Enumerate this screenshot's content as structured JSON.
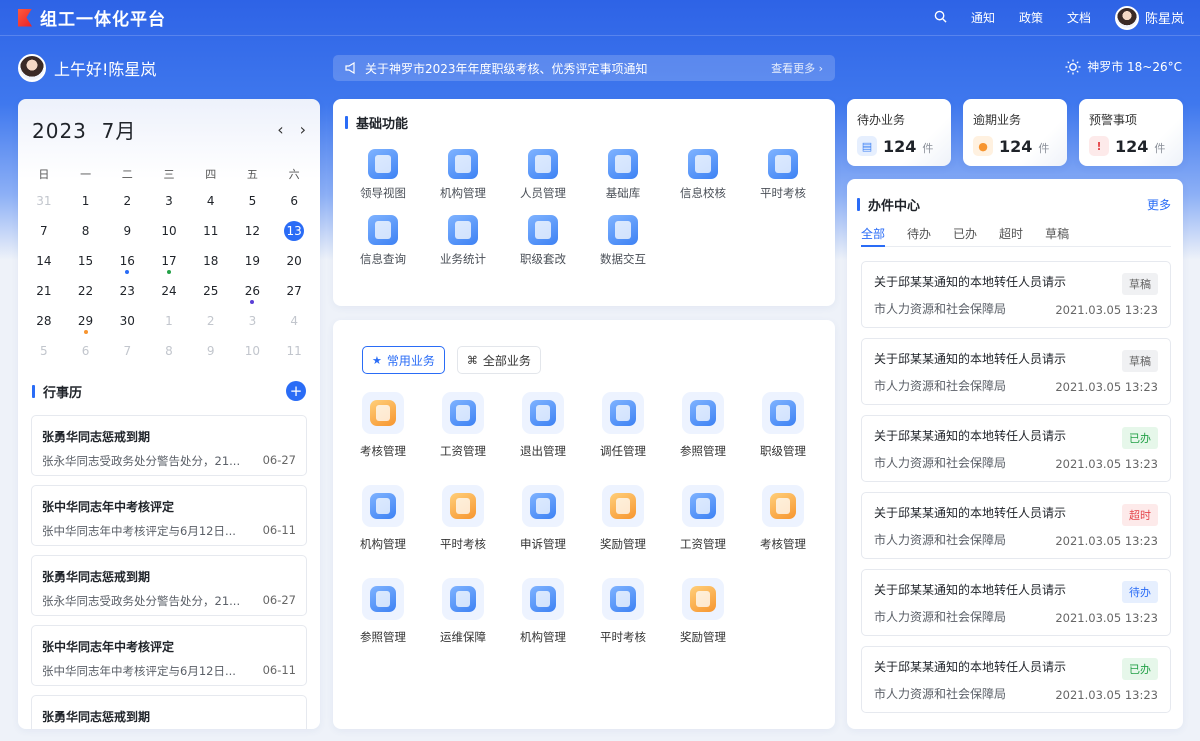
{
  "app": {
    "title": "组工一体化平台"
  },
  "topnav": {
    "notify": "通知",
    "policy": "政策",
    "docs": "文档",
    "user": "陈星岚"
  },
  "greeting": "上午好!陈星岚",
  "notice": {
    "text": "关于神罗市2023年年度职级考核、优秀评定事项通知",
    "more": "查看更多"
  },
  "weather": {
    "text": "神罗市 18~26°C"
  },
  "calendar": {
    "title": "2023  7月",
    "weekdays": [
      "日",
      "一",
      "二",
      "三",
      "四",
      "五",
      "六"
    ],
    "days": [
      {
        "n": "31",
        "m": true
      },
      {
        "n": "1"
      },
      {
        "n": "2"
      },
      {
        "n": "3"
      },
      {
        "n": "4"
      },
      {
        "n": "5"
      },
      {
        "n": "6"
      },
      {
        "n": "7"
      },
      {
        "n": "8"
      },
      {
        "n": "9"
      },
      {
        "n": "10"
      },
      {
        "n": "11"
      },
      {
        "n": "12"
      },
      {
        "n": "13",
        "today": true
      },
      {
        "n": "14"
      },
      {
        "n": "15"
      },
      {
        "n": "16",
        "dot": "#2a6cf6"
      },
      {
        "n": "17",
        "dot": "#24a148"
      },
      {
        "n": "18"
      },
      {
        "n": "19"
      },
      {
        "n": "20"
      },
      {
        "n": "21"
      },
      {
        "n": "22"
      },
      {
        "n": "23"
      },
      {
        "n": "24"
      },
      {
        "n": "25"
      },
      {
        "n": "26",
        "dot": "#5b3fd6"
      },
      {
        "n": "27"
      },
      {
        "n": "28"
      },
      {
        "n": "29",
        "dot": "#f7952f"
      },
      {
        "n": "30"
      },
      {
        "n": "1",
        "m": true
      },
      {
        "n": "2",
        "m": true
      },
      {
        "n": "3",
        "m": true
      },
      {
        "n": "4",
        "m": true
      },
      {
        "n": "5",
        "m": true
      },
      {
        "n": "6",
        "m": true
      },
      {
        "n": "7",
        "m": true
      },
      {
        "n": "8",
        "m": true
      },
      {
        "n": "9",
        "m": true
      },
      {
        "n": "10",
        "m": true
      },
      {
        "n": "11",
        "m": true
      }
    ]
  },
  "schedule": {
    "title": "行事历",
    "items": [
      {
        "title": "张勇华同志惩戒到期",
        "desc": "张永华同志受政务处分警告处分，21...",
        "date": "06-27"
      },
      {
        "title": "张中华同志年中考核评定",
        "desc": "张中华同志年中考核评定与6月12日...",
        "date": "06-11"
      },
      {
        "title": "张勇华同志惩戒到期",
        "desc": "张永华同志受政务处分警告处分，21...",
        "date": "06-27"
      },
      {
        "title": "张中华同志年中考核评定",
        "desc": "张中华同志年中考核评定与6月12日...",
        "date": "06-11"
      },
      {
        "title": "张勇华同志惩戒到期",
        "desc": "",
        "date": ""
      }
    ]
  },
  "basic": {
    "title": "基础功能",
    "items": [
      {
        "label": "领导视图",
        "icon": "leader-icon"
      },
      {
        "label": "机构管理",
        "icon": "building-icon"
      },
      {
        "label": "人员管理",
        "icon": "person-icon"
      },
      {
        "label": "基础库",
        "icon": "library-icon"
      },
      {
        "label": "信息校核",
        "icon": "check-icon"
      },
      {
        "label": "平时考核",
        "icon": "assessment-icon"
      },
      {
        "label": "信息查询",
        "icon": "query-icon"
      },
      {
        "label": "业务统计",
        "icon": "stats-icon"
      },
      {
        "label": "职级套改",
        "icon": "rank-icon"
      },
      {
        "label": "数据交互",
        "icon": "data-exchange-icon"
      }
    ]
  },
  "business": {
    "tabs": [
      "常用业务",
      "全部业务"
    ],
    "items": [
      {
        "label": "考核管理",
        "c": "orange"
      },
      {
        "label": "工资管理",
        "c": "blue"
      },
      {
        "label": "退出管理",
        "c": "blue"
      },
      {
        "label": "调任管理",
        "c": "blue"
      },
      {
        "label": "参照管理",
        "c": "blue"
      },
      {
        "label": "职级管理",
        "c": "blue"
      },
      {
        "label": "机构管理",
        "c": "blue"
      },
      {
        "label": "平时考核",
        "c": "orange"
      },
      {
        "label": "申诉管理",
        "c": "blue"
      },
      {
        "label": "奖励管理",
        "c": "orange"
      },
      {
        "label": "工资管理",
        "c": "blue"
      },
      {
        "label": "考核管理",
        "c": "orange"
      },
      {
        "label": "参照管理",
        "c": "blue"
      },
      {
        "label": "运维保障",
        "c": "blue"
      },
      {
        "label": "机构管理",
        "c": "blue"
      },
      {
        "label": "平时考核",
        "c": "blue"
      },
      {
        "label": "奖励管理",
        "c": "orange"
      }
    ]
  },
  "stats": [
    {
      "label": "待办业务",
      "value": "124",
      "unit": "件",
      "color": "#3e82f4",
      "bg": "#e6effe"
    },
    {
      "label": "逾期业务",
      "value": "124",
      "unit": "件",
      "color": "#f7952f",
      "bg": "#fff1e0"
    },
    {
      "label": "预警事项",
      "value": "124",
      "unit": "件",
      "color": "#e5484d",
      "bg": "#fdeaea"
    }
  ],
  "office": {
    "title": "办件中心",
    "more": "更多",
    "tabs": [
      "全部",
      "待办",
      "已办",
      "超时",
      "草稿"
    ],
    "items": [
      {
        "title": "关于邱某某通知的本地转任人员请示",
        "org": "市人力资源和社会保障局",
        "time": "2021.03.05 13:23",
        "status": "草稿",
        "cls": "b-draft"
      },
      {
        "title": "关于邱某某通知的本地转任人员请示",
        "org": "市人力资源和社会保障局",
        "time": "2021.03.05 13:23",
        "status": "草稿",
        "cls": "b-draft"
      },
      {
        "title": "关于邱某某通知的本地转任人员请示",
        "org": "市人力资源和社会保障局",
        "time": "2021.03.05 13:23",
        "status": "已办",
        "cls": "b-done"
      },
      {
        "title": "关于邱某某通知的本地转任人员请示",
        "org": "市人力资源和社会保障局",
        "time": "2021.03.05 13:23",
        "status": "超时",
        "cls": "b-late"
      },
      {
        "title": "关于邱某某通知的本地转任人员请示",
        "org": "市人力资源和社会保障局",
        "time": "2021.03.05 13:23",
        "status": "待办",
        "cls": "b-todo"
      },
      {
        "title": "关于邱某某通知的本地转任人员请示",
        "org": "市人力资源和社会保障局",
        "time": "2021.03.05 13:23",
        "status": "已办",
        "cls": "b-done"
      }
    ]
  }
}
